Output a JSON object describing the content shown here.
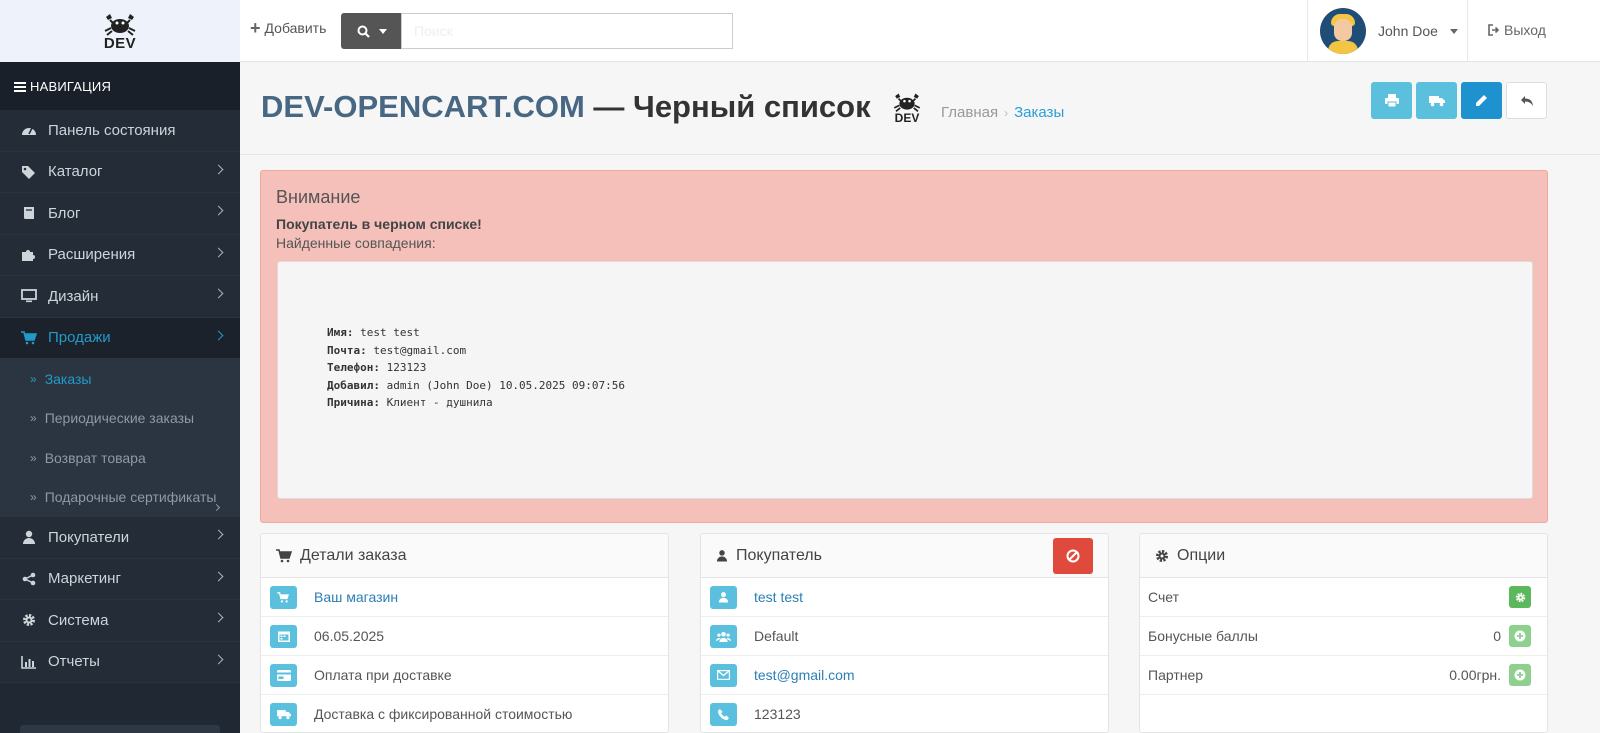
{
  "header": {
    "logo_text": "DEV",
    "add_label": "Добавить",
    "search_placeholder": "Поиск",
    "user_name": "John Doe",
    "logout_label": "Выход"
  },
  "sidebar": {
    "title": "НАВИГАЦИЯ",
    "items": [
      {
        "label": "Панель состояния",
        "icon": "dashboard-icon"
      },
      {
        "label": "Каталог",
        "icon": "tags-icon"
      },
      {
        "label": "Блог",
        "icon": "book-icon"
      },
      {
        "label": "Расширения",
        "icon": "puzzle-icon"
      },
      {
        "label": "Дизайн",
        "icon": "monitor-icon"
      },
      {
        "label": "Продажи",
        "icon": "cart-icon"
      }
    ],
    "sub_items": [
      {
        "label": "Заказы"
      },
      {
        "label": "Периодические заказы"
      },
      {
        "label": "Возврат товара"
      },
      {
        "label": "Подарочные сертификаты"
      }
    ],
    "items_after": [
      {
        "label": "Покупатели",
        "icon": "user-icon"
      },
      {
        "label": "Маркетинг",
        "icon": "share-icon"
      },
      {
        "label": "Система",
        "icon": "gear-icon"
      },
      {
        "label": "Отчеты",
        "icon": "bar-chart-icon"
      }
    ]
  },
  "page": {
    "title_site": "DEV-OPENCART.COM",
    "title_rest": " — Черный список",
    "mini_logo_text": "DEV",
    "breadcrumb": [
      "Главная",
      "Заказы"
    ]
  },
  "alert": {
    "heading": "Внимание",
    "bold_text": "Покупатель в черном списке!",
    "sub_text": "Найденные совпадения:",
    "lines": [
      {
        "key": "Имя:",
        "value": " test test"
      },
      {
        "key": "Почта:",
        "value": " test@gmail.com"
      },
      {
        "key": "Телефон:",
        "value": " 123123"
      },
      {
        "key": "Добавил:",
        "value": " admin (John Doe) 10.05.2025 09:07:56"
      },
      {
        "key": "Причина:",
        "value": " Клиент - душнила"
      }
    ]
  },
  "order_panel": {
    "title": "Детали заказа",
    "rows": [
      {
        "text": "Ваш магазин",
        "icon": "cart-icon"
      },
      {
        "text": "06.05.2025",
        "icon": "calendar-icon"
      },
      {
        "text": "Оплата при доставке",
        "icon": "credit-card-icon"
      },
      {
        "text": "Доставка с фиксированной стоимостью",
        "icon": "truck-icon"
      }
    ]
  },
  "customer_panel": {
    "title": "Покупатель",
    "rows": [
      {
        "text": "test test",
        "icon": "user-icon"
      },
      {
        "text": "Default",
        "icon": "group-icon"
      },
      {
        "text": "test@gmail.com",
        "icon": "envelope-icon"
      },
      {
        "text": "123123",
        "icon": "phone-icon"
      }
    ]
  },
  "options_panel": {
    "title": "Опции",
    "rows": [
      {
        "label": "Счет",
        "value": ""
      },
      {
        "label": "Бонусные баллы",
        "value": "0"
      },
      {
        "label": "Партнер",
        "value": "0.00грн."
      }
    ]
  },
  "colors": {
    "accent": "#229ac8",
    "sidebar_bg": "#1f2833",
    "alert_bg": "#f4c0b9",
    "danger": "#e04a3c",
    "success": "#5cb85c",
    "info": "#5bc0de"
  }
}
